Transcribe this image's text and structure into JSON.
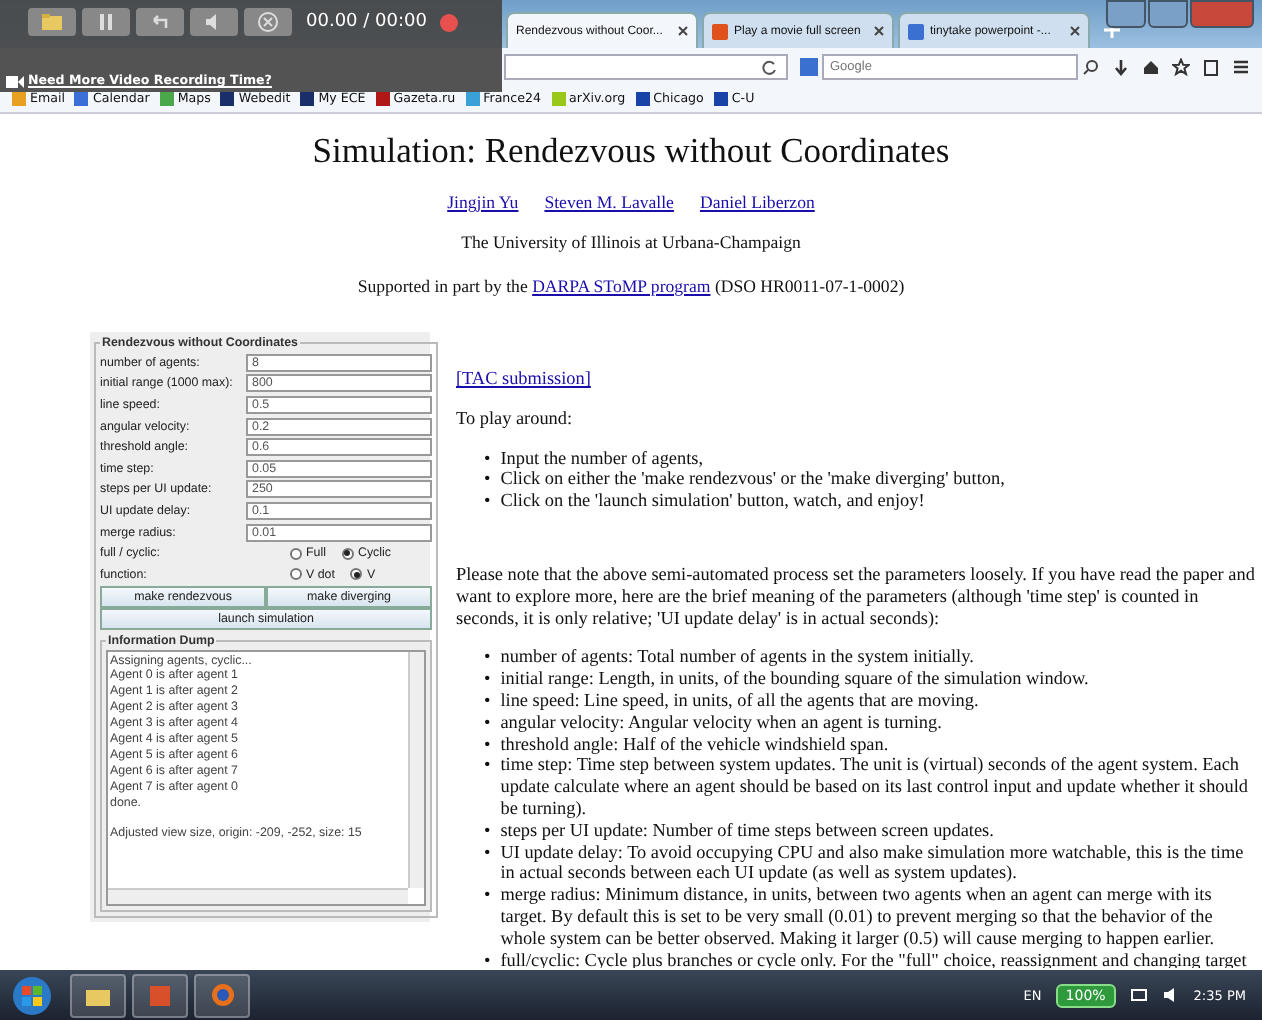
{
  "recorder": {
    "time": "00.00 / 00:00",
    "promo": "Need More Video Recording Time?"
  },
  "browser": {
    "tabs": [
      {
        "label": "Rendezvous without Coor...",
        "selected": true
      },
      {
        "label": "Play a movie full screen",
        "selected": false
      },
      {
        "label": "tinytake powerpoint -...",
        "selected": false
      }
    ],
    "search": {
      "placeholder": "Google"
    },
    "bookmarks": [
      {
        "label": "Email",
        "color": "#e8a020"
      },
      {
        "label": "Calendar",
        "color": "#3b6fd8"
      },
      {
        "label": "Maps",
        "color": "#4aa84a"
      },
      {
        "label": "Webedit",
        "color": "#1a2f6a"
      },
      {
        "label": "My ECE",
        "color": "#1a2f6a"
      },
      {
        "label": "Gazeta.ru",
        "color": "#b01818"
      },
      {
        "label": "France24",
        "color": "#3aa0d8"
      },
      {
        "label": "arXiv.org",
        "color": "#9ac81a"
      },
      {
        "label": "Chicago",
        "color": "#1844a8"
      },
      {
        "label": "C-U",
        "color": "#1844a8"
      }
    ]
  },
  "page": {
    "title": "Simulation: Rendezvous without Coordinates",
    "authors": [
      "Jingjin Yu",
      "Steven M. Lavalle",
      "Daniel Liberzon"
    ],
    "affiliation": "The University of Illinois at Urbana-Champaign",
    "support": {
      "before": "Supported in part by the",
      "link": "DARPA SToMP program",
      "after": "(DSO HR0011-07-1-0002)"
    },
    "applet": {
      "title": "Rendezvous without Coordinates",
      "params": [
        {
          "label": "number of agents:",
          "value": "8"
        },
        {
          "label": "initial range (1000 max):",
          "value": "800"
        },
        {
          "label": "line speed:",
          "value": "0.5"
        },
        {
          "label": "angular velocity:",
          "value": "0.2"
        },
        {
          "label": "threshold angle:",
          "value": "0.6"
        },
        {
          "label": "time step:",
          "value": "0.05"
        },
        {
          "label": "steps per UI update:",
          "value": "250"
        },
        {
          "label": "UI update delay:",
          "value": "0.1"
        },
        {
          "label": "merge radius:",
          "value": "0.01"
        }
      ],
      "choices": [
        {
          "label": "full / cyclic:",
          "options": [
            {
              "label": "Full",
              "selected": false
            },
            {
              "label": "Cyclic",
              "selected": true
            }
          ]
        },
        {
          "label": "function:",
          "options": [
            {
              "label": "V dot",
              "selected": false
            },
            {
              "label": "V",
              "selected": true
            }
          ]
        }
      ],
      "buttons": [
        "make rendezvous",
        "make diverging"
      ],
      "launch": "launch simulation",
      "dump": {
        "title": "Information Dump",
        "lines": [
          "Assigning agents, cyclic...",
          "Agent 0 is after agent 1",
          "Agent 1 is after agent 2",
          "Agent 2 is after agent 3",
          "Agent 3 is after agent 4",
          "Agent 4 is after agent 5",
          "Agent 5 is after agent 6",
          "Agent 6 is after agent 7",
          "Agent 7 is after agent 0",
          "done.",
          "Adjusted view size, origin: -209, -252, size: 15"
        ]
      }
    },
    "bullet": "•",
    "tac": "[TAC submission]",
    "intro": "To play around:",
    "steps": [
      "Input the number of agents,",
      "Click on either the 'make rendezvous' or the 'make diverging' button,",
      "Click on the 'launch simulation' button, watch, and enjoy!"
    ],
    "note": "Please note that the above semi-automated process set the parameters loosely. If you have read the paper and want to explore more, here are the brief meaning of the parameters (although 'time step' is counted in seconds, it is only relative; 'UI update delay' is in actual seconds):",
    "definitions": [
      "number of agents: Total number of agents in the system initially.",
      "initial range: Length, in units, of the bounding square of the simulation window.",
      "line speed: Line speed, in units, of all the agents that are moving.",
      "angular velocity: Angular velocity when an agent is turning.",
      "threshold angle: Half of the vehicle windshield span.",
      "time step: Time step between system updates. The unit is (virtual) seconds of the agent system. Each update calculate where an agent should be based on its last control input and update whether it should be turning).",
      "steps per UI update: Number of time steps between screen updates.",
      "UI update delay: To avoid occupying CPU and also make simulation more watchable, this is the time in actual seconds between each UI update (as well as system updates).",
      "merge radius: Minimum distance, in units, between two agents when an agent can merge with its target. By default this is set to be very small (0.01) to prevent merging so that the behavior of the whole system can be better observed. Making it larger (0.5) will cause merging to happen earlier.",
      "full/cyclic: Cycle plus branches or cycle only. For the \"full\" choice, reassignment and changing target"
    ]
  },
  "taskbar": {
    "language": "EN",
    "zoom": "100%",
    "clock": "2:35 PM"
  }
}
